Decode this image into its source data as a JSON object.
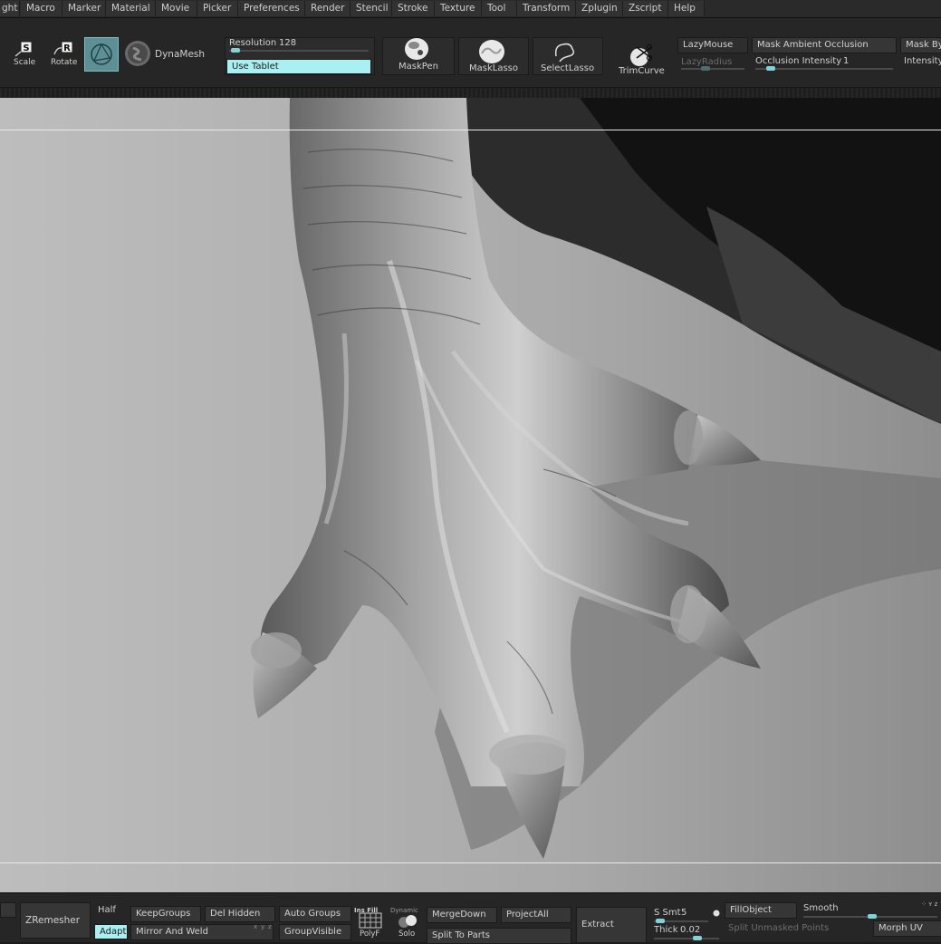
{
  "menu": [
    "ght",
    "Macro",
    "Marker",
    "Material",
    "Movie",
    "Picker",
    "Preferences",
    "Render",
    "Stencil",
    "Stroke",
    "Texture",
    "Tool",
    "Transform",
    "Zplugin",
    "Zscript",
    "Help"
  ],
  "toolbar": {
    "scale_label": "Scale",
    "rotate_label": "Rotate",
    "dynamesh_label": "DynaMesh",
    "resolution_label": "Resolution",
    "resolution_value": "128",
    "use_tablet_label": "Use Tablet",
    "maskpen_label": "MaskPen",
    "masklasso_label": "MaskLasso",
    "selectlasso_label": "SelectLasso",
    "trimcurve_label": "TrimCurve",
    "lazymouse_label": "LazyMouse",
    "lazyradius_label": "LazyRadius",
    "mask_ao_label": "Mask Ambient Occlusion",
    "occlusion_intensity_label": "Occlusion Intensity",
    "occlusion_intensity_value": "1",
    "mask_by_label": "Mask By",
    "intensity_label": "Intensity"
  },
  "bottom": {
    "zremesher_label": "ZRemesher",
    "half_label": "Half",
    "adapt_label": "Adapt",
    "keepgroups_label": "KeepGroups",
    "mirror_weld_label": "Mirror And Weld",
    "del_hidden_label": "Del Hidden",
    "auto_groups_label": "Auto Groups",
    "groupvisible_label": "GroupVisible",
    "insfill_label": "Ins Fill",
    "polyf_label": "PolyF",
    "dynamic_label": "Dynamic",
    "solo_label": "Solo",
    "mergedown_label": "MergeDown",
    "split_to_parts_label": "Split To Parts",
    "projectall_label": "ProjectAll",
    "extract_label": "Extract",
    "ssmt_label": "S Smt",
    "ssmt_value": "5",
    "thick_label": "Thick",
    "thick_value": "0.02",
    "fillobject_label": "FillObject",
    "split_unmasked_label": "Split Unmasked Points",
    "smooth_label": "Smooth",
    "morph_uv_label": "Morph UV",
    "axis_x": "x",
    "axis_y": "y",
    "axis_z": "z"
  },
  "colors": {
    "accent": "#a8f0f2",
    "slider_knob": "#7fd3d9",
    "panel": "#303030",
    "background": "#262626"
  }
}
